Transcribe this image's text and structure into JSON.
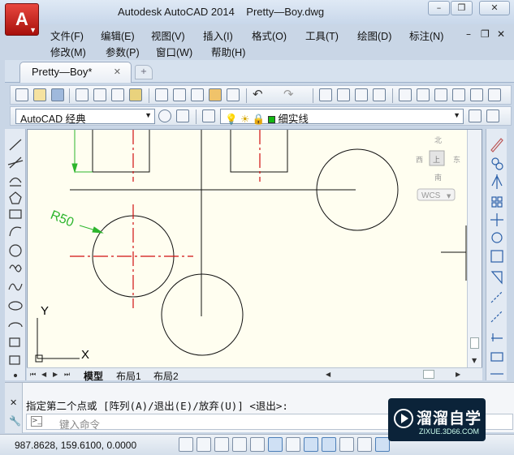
{
  "window": {
    "app_title": "Autodesk AutoCAD 2014",
    "file_title": "Pretty—Boy.dwg",
    "logo_letter": "A"
  },
  "menus": {
    "row1": [
      "文件(F)",
      "编辑(E)",
      "视图(V)",
      "插入(I)",
      "格式(O)",
      "工具(T)",
      "绘图(D)",
      "标注(N)"
    ],
    "row2": [
      "修改(M)",
      "参数(P)",
      "窗口(W)",
      "帮助(H)"
    ]
  },
  "tabs": {
    "active": "Pretty—Boy*"
  },
  "toolbar": {
    "workspace": "AutoCAD 经典",
    "layer_name": "细实线"
  },
  "canvas": {
    "dimension_label": "R50",
    "compass": {
      "north": "北",
      "south": "南",
      "east": "东",
      "west": "西",
      "center": "上"
    },
    "wcs_label": "WCS",
    "ucs_x": "X",
    "ucs_y": "Y",
    "colors": {
      "background": "#fffef0",
      "geometry": "#111111",
      "centerline": "#d01010",
      "dimension": "#2db52d"
    }
  },
  "layouts": {
    "tabs": [
      "模型",
      "布局1",
      "布局2"
    ],
    "active": "模型"
  },
  "command": {
    "history_line": "指定第二个点或 [阵列(A)/退出(E)/放弃(U)] <退出>:",
    "input_placeholder": "键入命令"
  },
  "status": {
    "coordinates": "987.8628, 159.6100, 0.0000"
  },
  "watermark": {
    "title": "溜溜自学",
    "subtitle": "ZIXUE.3D66.COM"
  }
}
